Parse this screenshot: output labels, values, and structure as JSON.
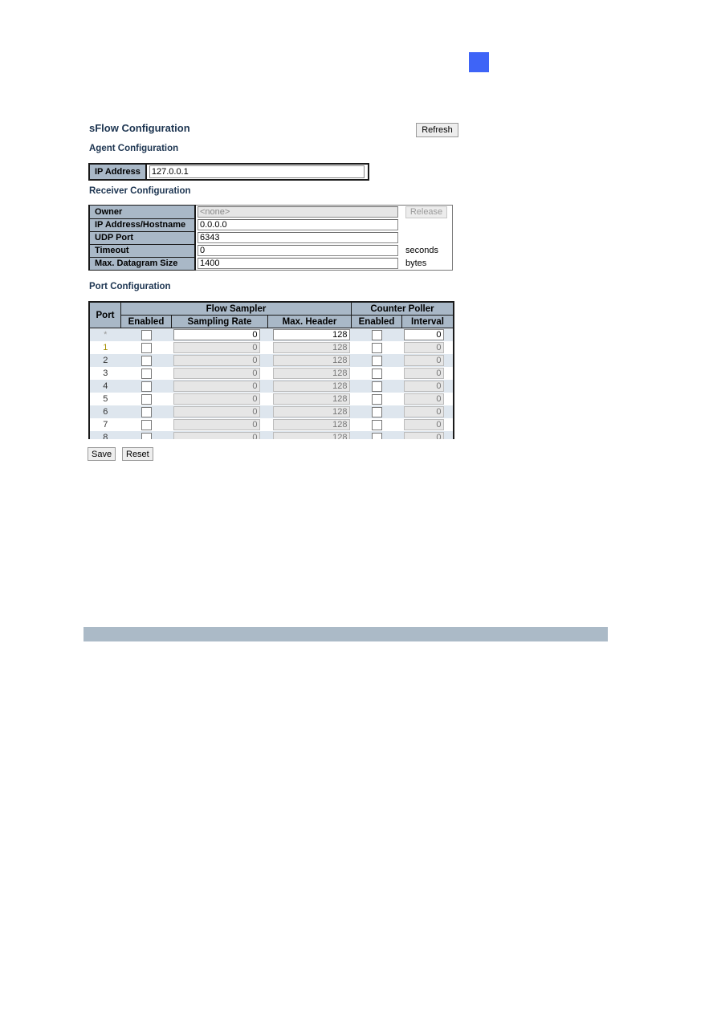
{
  "page": {
    "title": "sFlow Configuration",
    "refresh_label": "Refresh",
    "corner_marker_color": "#3e64f7",
    "footer_bar_color": "#abbac7"
  },
  "agent": {
    "section_title": "Agent Configuration",
    "ip_label": "IP Address",
    "ip_value": "127.0.0.1"
  },
  "receiver": {
    "section_title": "Receiver Configuration",
    "owner_label": "Owner",
    "owner_value": "<none>",
    "release_label": "Release",
    "host_label": "IP Address/Hostname",
    "host_value": "0.0.0.0",
    "udp_label": "UDP Port",
    "udp_value": "6343",
    "timeout_label": "Timeout",
    "timeout_value": "0",
    "timeout_unit": "seconds",
    "datagram_label": "Max. Datagram Size",
    "datagram_value": "1400",
    "datagram_unit": "bytes"
  },
  "ports": {
    "section_title": "Port Configuration",
    "headers": {
      "port": "Port",
      "flow_sampler": "Flow Sampler",
      "counter_poller": "Counter Poller",
      "fs_enabled": "Enabled",
      "sampling_rate": "Sampling Rate",
      "max_header": "Max. Header",
      "cp_enabled": "Enabled",
      "interval": "Interval"
    },
    "rows": [
      {
        "port": "*",
        "fs_enabled": false,
        "sampling_rate": "0",
        "max_header": "128",
        "cp_enabled": false,
        "interval": "0"
      },
      {
        "port": "1",
        "fs_enabled": false,
        "sampling_rate": "0",
        "max_header": "128",
        "cp_enabled": false,
        "interval": "0"
      },
      {
        "port": "2",
        "fs_enabled": false,
        "sampling_rate": "0",
        "max_header": "128",
        "cp_enabled": false,
        "interval": "0"
      },
      {
        "port": "3",
        "fs_enabled": false,
        "sampling_rate": "0",
        "max_header": "128",
        "cp_enabled": false,
        "interval": "0"
      },
      {
        "port": "4",
        "fs_enabled": false,
        "sampling_rate": "0",
        "max_header": "128",
        "cp_enabled": false,
        "interval": "0"
      },
      {
        "port": "5",
        "fs_enabled": false,
        "sampling_rate": "0",
        "max_header": "128",
        "cp_enabled": false,
        "interval": "0"
      },
      {
        "port": "6",
        "fs_enabled": false,
        "sampling_rate": "0",
        "max_header": "128",
        "cp_enabled": false,
        "interval": "0"
      },
      {
        "port": "7",
        "fs_enabled": false,
        "sampling_rate": "0",
        "max_header": "128",
        "cp_enabled": false,
        "interval": "0"
      },
      {
        "port": "8",
        "fs_enabled": false,
        "sampling_rate": "0",
        "max_header": "128",
        "cp_enabled": false,
        "interval": "0"
      }
    ]
  },
  "actions": {
    "save_label": "Save",
    "reset_label": "Reset"
  }
}
